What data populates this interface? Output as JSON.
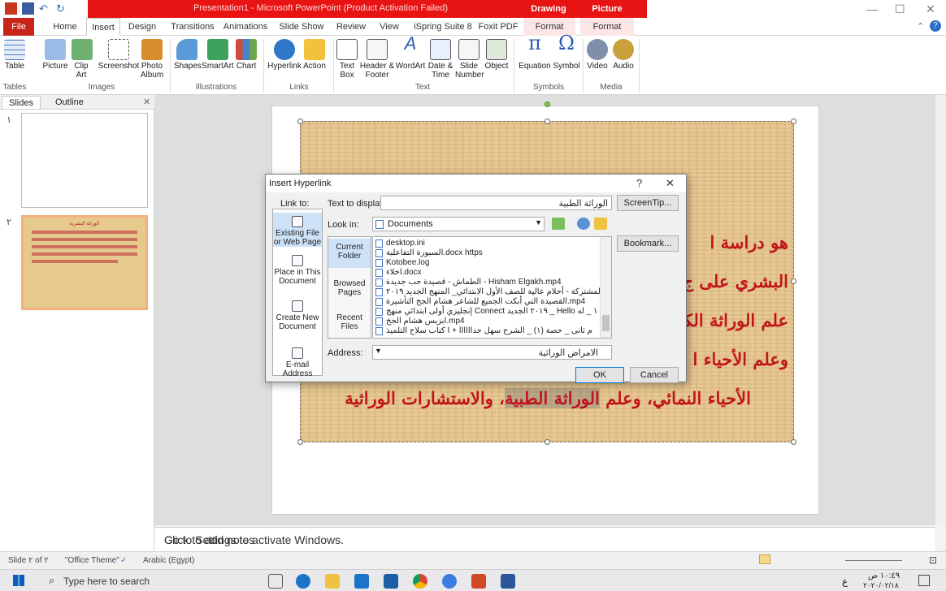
{
  "window": {
    "title": "Presentation1 - Microsoft PowerPoint (Product Activation Failed)",
    "ctx_drawing": "Drawing Tools",
    "ctx_picture": "Picture Tools",
    "minimize": "—",
    "maximize": "☐",
    "close": "✕"
  },
  "tabs": [
    "File",
    "Home",
    "Insert",
    "Design",
    "Transitions",
    "Animations",
    "Slide Show",
    "Review",
    "View",
    "iSpring Suite 8",
    "Foxit PDF",
    "Format",
    "Format"
  ],
  "ribbon": {
    "buttons": [
      "Table",
      "Picture",
      "Clip Art",
      "Screenshot",
      "Photo Album",
      "Shapes",
      "SmartArt",
      "Chart",
      "Hyperlink",
      "Action",
      "Text Box",
      "Header & Footer",
      "WordArt",
      "Date & Time",
      "Slide Number",
      "Object",
      "Equation",
      "Symbol",
      "Video",
      "Audio"
    ],
    "groups": [
      "Tables",
      "Images",
      "Illustrations",
      "Links",
      "Text",
      "Symbols",
      "Media"
    ]
  },
  "panel": {
    "tab_slides": "Slides",
    "tab_outline": "Outline",
    "close": "✕",
    "slide1_num": "١",
    "slide2_num": "٢",
    "thumb_title": "الوراثة البشرية"
  },
  "slide": {
    "lines": [
      "هو دراسة ا",
      "البشري على ج",
      "علم الوراثة الكل",
      "وعلم الأحياء ا",
      "الأحياء النمائي، وعلم الوراثة الطبية، والاستشارات الوراثية"
    ],
    "highlight": "الوراثة الطبية"
  },
  "dialog": {
    "title": "Insert Hyperlink",
    "help": "?",
    "close": "✕",
    "link_to_label": "Link to:",
    "text_to_display_label": "Text to display:",
    "text_to_display_value": "الوراثة الطبية",
    "screentip": "ScreenTip...",
    "look_in_label": "Look in:",
    "look_in_value": "Documents",
    "bookmark": "Bookmark...",
    "address_label": "Address:",
    "address_value": "الامراض الوراثية",
    "ok": "OK",
    "cancel": "Cancel",
    "link_options": [
      "Existing File or Web Page",
      "Place in This Document",
      "Create New Document",
      "E-mail Address"
    ],
    "folder_options": [
      "Current Folder",
      "Browsed Pages",
      "Recent Files"
    ],
    "files": [
      "desktop.ini",
      "السبورة التفاعلية.docx https",
      "Kotobee.log",
      "اخلاء.docx",
      "الطماش - قصيدة حب جديدة - Hisham Elgakh.mp4",
      "لمشتركة - أحلام عالية للصف الأول الابتدائي_ المنهج الجديد ٢٠١٩",
      "القصيدة التي أبكت الجميع للشاعر هشام الجخ التأشيرة.mp4",
      "إنجليزي أولى ابتدائي منهج Connect ٢٠١٩ الجديد _ Hello ١ _ له",
      "ابزيس هشام الجخ.mp4",
      "م ثانى _ حصة (١) _ الشرح سهل جداااااا + ا كتاب سلاح التلميذ"
    ]
  },
  "notes": {
    "placeholder": "Click to add notes",
    "activate": "Go to Settings to activate Windows."
  },
  "status": {
    "slide": "Slide ٢ of ٢",
    "theme": "\"Office Theme\"",
    "lang": "Arabic (Egypt)"
  },
  "taskbar": {
    "search": "Type here to search",
    "time": "١٠:٤٩ ص",
    "date": "٢٠٢٠/٠٢/١٨",
    "ime": "ع"
  }
}
